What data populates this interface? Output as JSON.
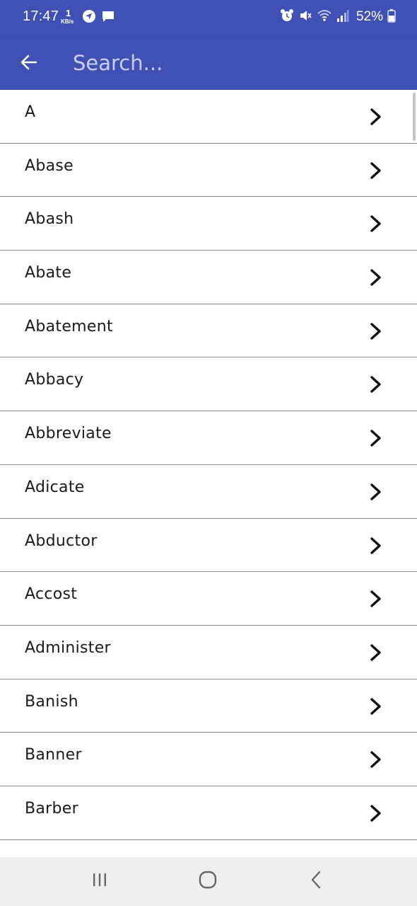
{
  "status_bar": {
    "time": "17:47",
    "net_speed_value": "1",
    "net_speed_unit": "KB/s",
    "battery_percent": "52%",
    "icons": [
      "navigation-icon",
      "message-icon",
      "alarm-icon",
      "mute-icon",
      "wifi-icon",
      "signal-icon",
      "battery-icon"
    ]
  },
  "app_bar": {
    "back_icon": "arrow-left-icon",
    "search_placeholder": "Search...",
    "search_value": ""
  },
  "words": [
    "A",
    "Abase",
    "Abash",
    "Abate",
    "Abatement",
    "Abbacy",
    "Abbreviate",
    "Adicate",
    "Abductor",
    "Accost",
    "Administer",
    "Banish",
    "Banner",
    "Barber"
  ],
  "row_icon": "chevron-right-icon",
  "nav_bar": {
    "icons": [
      "recent-apps-icon",
      "home-icon",
      "back-icon"
    ]
  },
  "colors": {
    "primary": "#3f51b5",
    "placeholder": "#c9cef2",
    "divider": "#8a8a8a",
    "nav_bg": "#efefef"
  }
}
